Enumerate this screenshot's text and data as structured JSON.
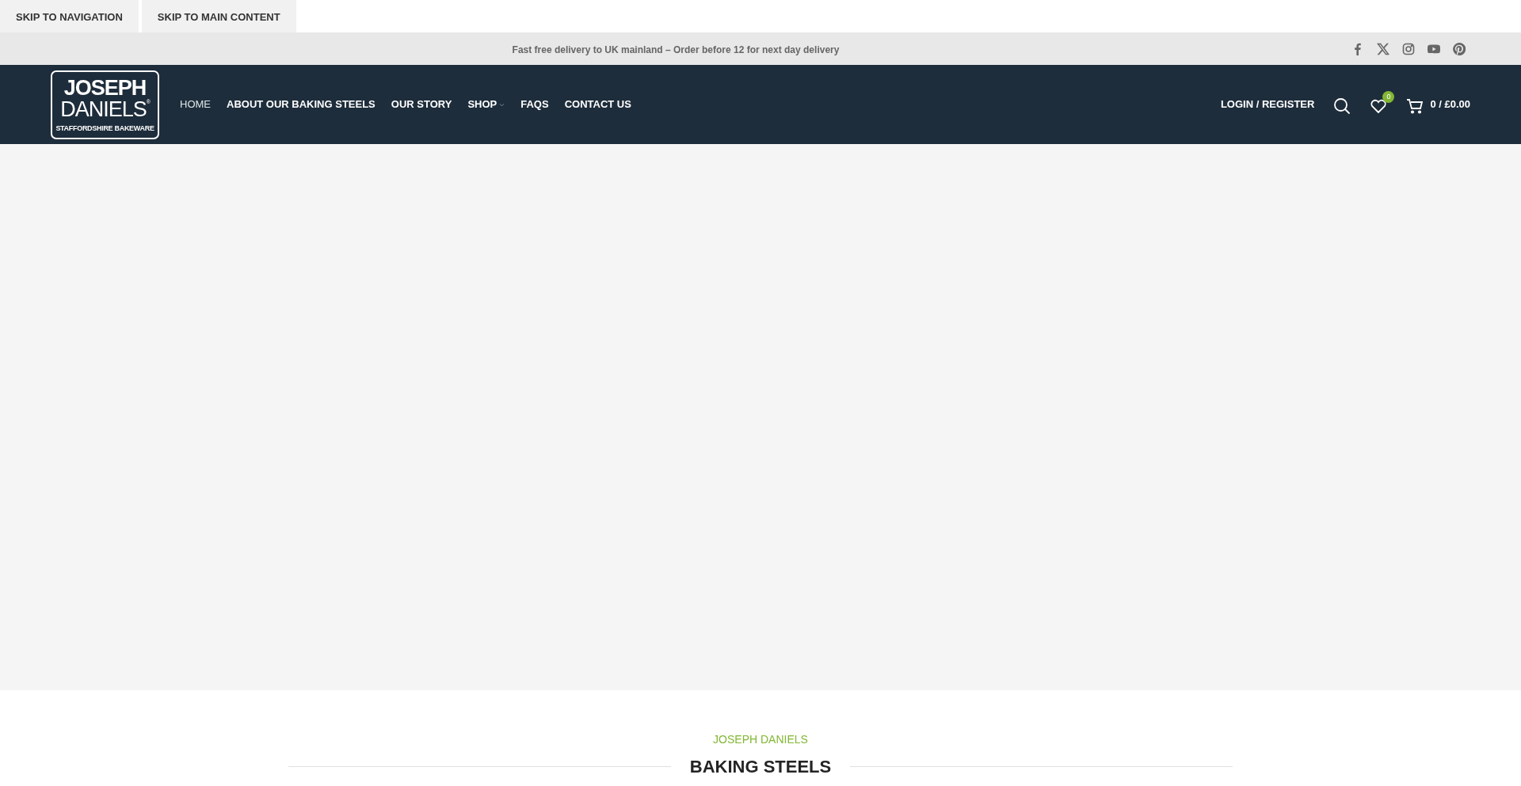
{
  "skip_links": [
    "SKIP TO NAVIGATION",
    "SKIP TO MAIN CONTENT"
  ],
  "top_bar": {
    "message": "Fast free delivery to UK mainland – Order before 12 for next day delivery",
    "social": [
      {
        "kind": "facebook"
      },
      {
        "kind": "x"
      },
      {
        "kind": "instagram"
      },
      {
        "kind": "youtube"
      },
      {
        "kind": "pinterest"
      }
    ]
  },
  "logo": {
    "line_1": "JOSEPH",
    "line_2": "DANIELS",
    "mark": "®",
    "tagline": "STAFFORDSHIRE BAKEWARE"
  },
  "nav": [
    {
      "label": "HOME",
      "selected": true,
      "dropdown": false
    },
    {
      "label": "ABOUT OUR BAKING STEELS",
      "selected": false,
      "dropdown": false
    },
    {
      "label": "OUR STORY",
      "selected": false,
      "dropdown": false
    },
    {
      "label": "SHOP",
      "selected": false,
      "dropdown": true
    },
    {
      "label": "FAQS",
      "selected": false,
      "dropdown": false
    },
    {
      "label": "CONTACT US",
      "selected": false,
      "dropdown": false
    }
  ],
  "account": {
    "login": "LOGIN / REGISTER",
    "wishlist_count": "0",
    "cart": "0 / £0.00"
  },
  "section": {
    "subtitle": "JOSEPH DANIELS",
    "title": "BAKING STEELS"
  }
}
